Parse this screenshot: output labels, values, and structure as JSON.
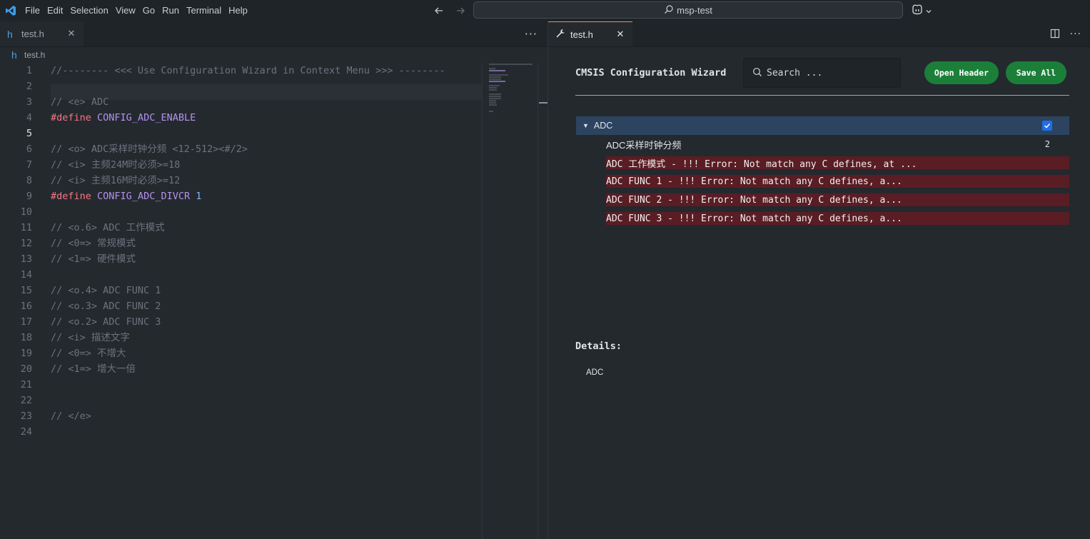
{
  "menu": [
    "File",
    "Edit",
    "Selection",
    "View",
    "Go",
    "Run",
    "Terminal",
    "Help"
  ],
  "command_center": {
    "label": "msp-test"
  },
  "left": {
    "tab_label": "test.h",
    "breadcrumb": "test.h",
    "lines": [
      {
        "n": "1",
        "text": "//-------- <<< Use Configuration Wizard in Context Menu >>> --------"
      },
      {
        "n": "2",
        "text": ""
      },
      {
        "n": "3",
        "text": "// <e> ADC"
      },
      {
        "n": "4",
        "kw": "#define",
        "macro": "CONFIG_ADC_ENABLE",
        "num": ""
      },
      {
        "n": "5",
        "text": ""
      },
      {
        "n": "6",
        "text": "// <o> ADC采样时钟分频 <12-512><#/2>"
      },
      {
        "n": "7",
        "text": "// <i> 主频24M时必须>=18"
      },
      {
        "n": "8",
        "text": "// <i> 主频16M时必须>=12"
      },
      {
        "n": "9",
        "kw": "#define",
        "macro": "CONFIG_ADC_DIVCR",
        "num": "1"
      },
      {
        "n": "10",
        "text": ""
      },
      {
        "n": "11",
        "text": "// <o.6> ADC 工作模式"
      },
      {
        "n": "12",
        "text": "// <0=> 常规模式"
      },
      {
        "n": "13",
        "text": "// <1=> 硬件模式"
      },
      {
        "n": "14",
        "text": ""
      },
      {
        "n": "15",
        "text": "// <o.4> ADC FUNC 1"
      },
      {
        "n": "16",
        "text": "// <o.3> ADC FUNC 2"
      },
      {
        "n": "17",
        "text": "// <o.2> ADC FUNC 3"
      },
      {
        "n": "18",
        "text": "// <i> 描述文字"
      },
      {
        "n": "19",
        "text": "// <0=> 不增大"
      },
      {
        "n": "20",
        "text": "// <1=> 增大一倍"
      },
      {
        "n": "21",
        "text": ""
      },
      {
        "n": "22",
        "text": ""
      },
      {
        "n": "23",
        "text": "// </e>"
      },
      {
        "n": "24",
        "text": ""
      }
    ]
  },
  "right": {
    "tab_label": "test.h",
    "wizard": {
      "title": "CMSIS Configuration Wizard",
      "search_placeholder": "Search ...",
      "open_header": "Open Header",
      "save_all": "Save All",
      "root_label": "ADC",
      "root_checked": true,
      "divider_label": "ADC采样时钟分频",
      "divider_value": "2",
      "errors": [
        "ADC 工作模式 - !!! Error: Not match any C defines, at ...",
        "ADC FUNC 1 - !!! Error: Not match any C defines, a...",
        "ADC FUNC 2 - !!! Error: Not match any C defines, a...",
        "ADC FUNC 3 - !!! Error: Not match any C defines, a..."
      ],
      "details_title": "Details:",
      "details_body": "ADC"
    }
  },
  "colors": {
    "accent_button": "#1b7f3a",
    "selection": "#2c4460",
    "error_row": "#5a1d24",
    "define_keyword": "#f97583",
    "macro": "#b392f0"
  }
}
